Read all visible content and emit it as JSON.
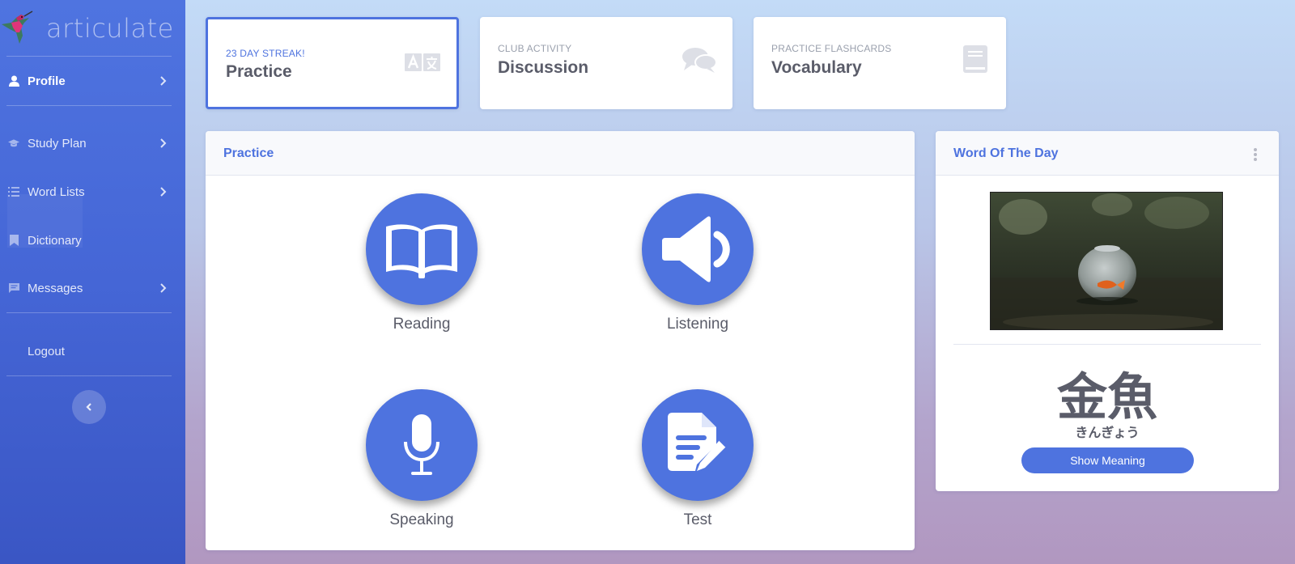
{
  "brand": {
    "name": "articulate",
    "logo_icon": "hummingbird-logo"
  },
  "sidebar": {
    "items": [
      {
        "label": "Profile",
        "icon": "user-icon",
        "has_chevron": true,
        "active": true
      },
      {
        "label": "Study Plan",
        "icon": "graduation-cap-icon",
        "has_chevron": true
      },
      {
        "label": "Word Lists",
        "icon": "list-icon",
        "has_chevron": true
      },
      {
        "label": "Dictionary",
        "icon": "bookmark-icon",
        "has_chevron": false
      },
      {
        "label": "Messages",
        "icon": "comment-icon",
        "has_chevron": true
      },
      {
        "label": "Logout",
        "icon": "",
        "has_chevron": false
      }
    ],
    "collapse_icon": "chevron-left-icon"
  },
  "top_cards": [
    {
      "subtitle": "23 Day Streak!",
      "title": "Practice",
      "icon": "language-icon",
      "active": true
    },
    {
      "subtitle": "Club Activity",
      "title": "Discussion",
      "icon": "comments-icon",
      "active": false
    },
    {
      "subtitle": "Practice Flashcards",
      "title": "Vocabulary",
      "icon": "book-icon",
      "active": false
    }
  ],
  "practice": {
    "title": "Practice",
    "skills": [
      {
        "label": "Reading",
        "icon": "open-book-icon"
      },
      {
        "label": "Listening",
        "icon": "volume-icon"
      },
      {
        "label": "Speaking",
        "icon": "microphone-icon"
      },
      {
        "label": "Test",
        "icon": "file-edit-icon"
      }
    ]
  },
  "word_of_the_day": {
    "title": "Word Of The Day",
    "word": "金魚",
    "reading": "きんぎょう",
    "button_label": "Show Meaning",
    "menu_icon": "ellipsis-vertical-icon",
    "image_icon": "goldfish-bowl-photo"
  },
  "colors": {
    "primary": "#4e73df",
    "text": "#5a5c69",
    "muted": "#9aa0ad",
    "sidebar_top": "#4f74e0",
    "sidebar_bottom": "#3a56c4"
  }
}
